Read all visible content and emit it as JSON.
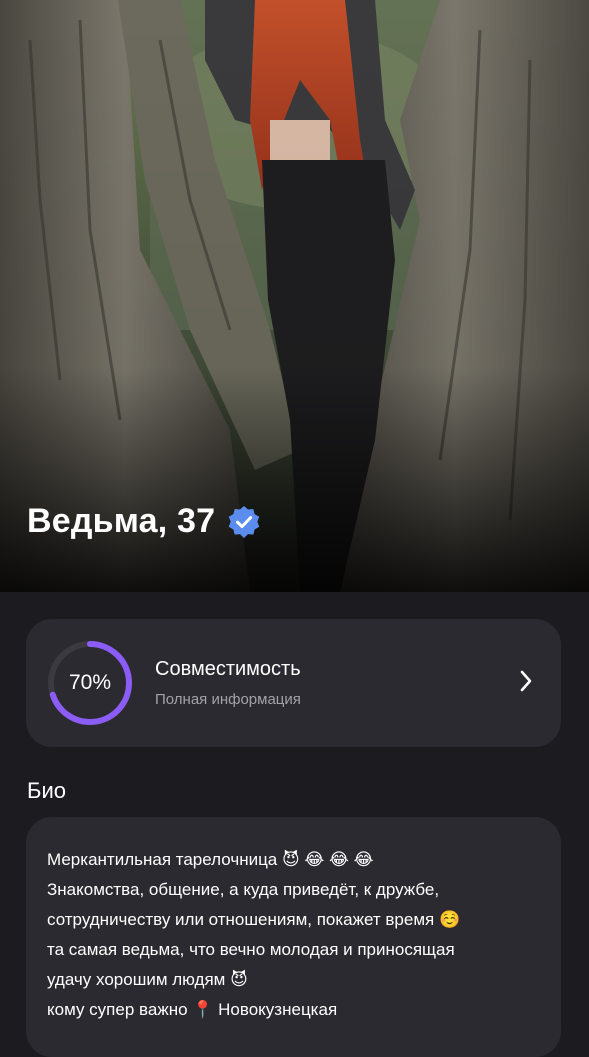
{
  "profile": {
    "name_age": "Ведьма, 37",
    "verified": true,
    "photo_icon": "profile-photo"
  },
  "compatibility": {
    "percent_label": "70%",
    "percent_value": 70,
    "title": "Совместимость",
    "subtitle": "Полная информация",
    "ring_color": "#8b5cf6",
    "icon": "chevron-right-icon"
  },
  "bio": {
    "heading": "Био",
    "lines": [
      "Меркантильная тарелочница 😈 😂 😂 😂",
      "Знакомства, общение, а куда  приведёт, к дружбе,",
      "сотрудничеству или отношениям, покажет время ☺️",
      "та самая ведьма, что вечно молодая и приносящая",
      "удачу хорошим людям 😈",
      "кому супер важно 📍 Новокузнецкая"
    ]
  },
  "colors": {
    "background": "#1c1b20",
    "card": "#2b2a30",
    "accent": "#8b5cf6",
    "verified_badge": "#5b8def"
  }
}
